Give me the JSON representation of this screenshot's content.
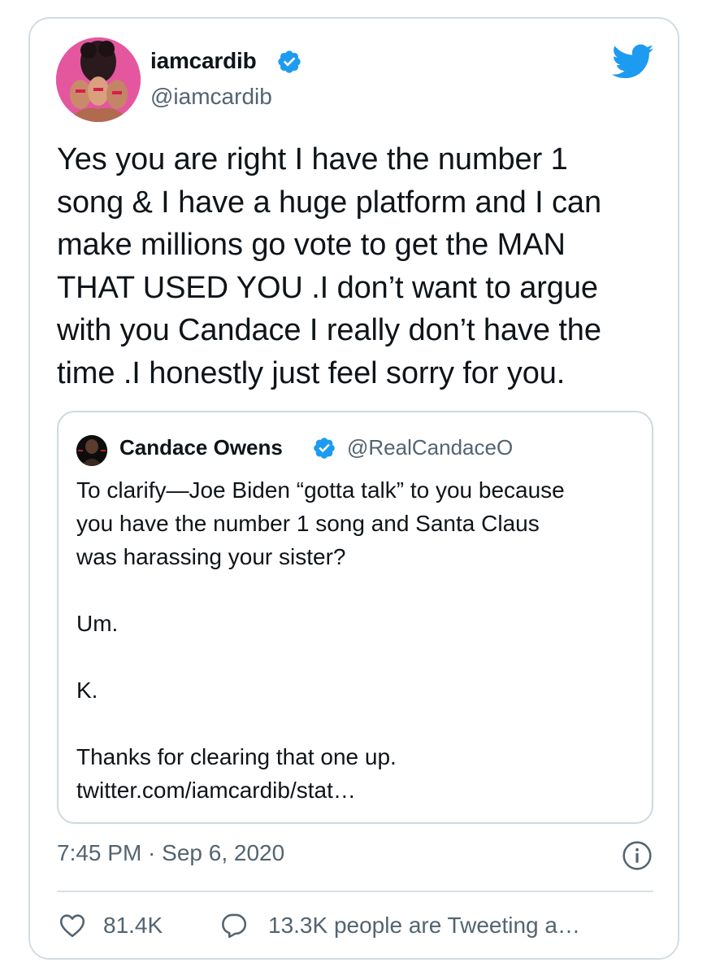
{
  "author": {
    "display_name": "iamcardib",
    "handle": "@iamcardib"
  },
  "tweet": {
    "text": "Yes you are right I have the number 1\nsong & I have a huge platform and I can\nmake millions go vote to get the MAN\nTHAT USED YOU .I don’t want to argue\nwith you Candace I really don’t have the\ntime .I honestly just feel sorry for you."
  },
  "quoted_tweet": {
    "display_name": "Candace Owens",
    "handle": "@RealCandaceO",
    "text": "To clarify—Joe Biden “gotta talk” to you because\nyou have the number 1 song and Santa Claus\nwas harassing your sister?\n\nUm.\n\nK.\n\nThanks for clearing that one up.",
    "link": "twitter.com/iamcardib/stat…"
  },
  "timestamp": "7:45 PM · Sep 6, 2020",
  "stats": {
    "likes": "81.4K",
    "replies_text": "13.3K people are Tweeting a…"
  },
  "icons": {
    "verified": "verified-badge-icon",
    "twitter_logo": "twitter-bird-icon",
    "info": "info-icon",
    "like": "heart-icon",
    "reply": "speech-bubble-icon"
  },
  "colors": {
    "twitter_blue": "#1d9bf0",
    "secondary_text": "#536471",
    "border": "#cfd9de"
  }
}
